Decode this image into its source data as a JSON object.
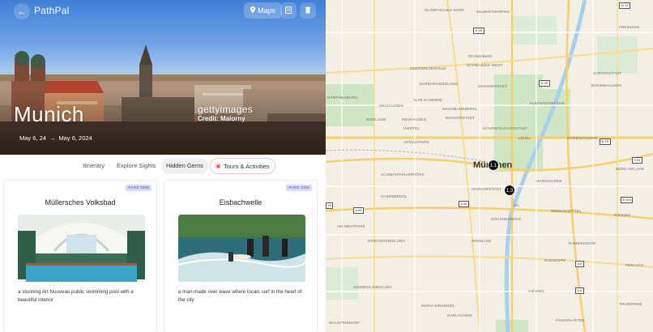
{
  "app": {
    "name": "PathPal",
    "maps_label": "Maps"
  },
  "hero": {
    "city": "Munich",
    "date_start": "May 6, 24",
    "date_arrow": "→",
    "date_end": "May 6, 2024",
    "watermark": "gettyimages",
    "credit": "Credit: Malorny"
  },
  "tabs": [
    {
      "label": "Itinerary"
    },
    {
      "label": "Explore Sights"
    },
    {
      "label": "Hidden Gems",
      "active": true
    },
    {
      "label": "Tours & Activities",
      "icon": "ticket-icon"
    }
  ],
  "cards": [
    {
      "title": "Müllersches Volksbad",
      "badge": "RARE GEM",
      "description": "a stunning Art Nouveau public swimming pool with a beautiful interior"
    },
    {
      "title": "Eisbachwelle",
      "badge": "RARE GEM",
      "description": "a man-made river wave where locals surf in the heart of the city"
    }
  ],
  "map": {
    "city": "München",
    "markers": [
      "1.1",
      "1.3"
    ],
    "districts": [
      "OLYMPISCHES DORF",
      "MILBERTSHOFEN",
      "OBERWIESENFELD",
      "SCHWABING",
      "FREIMANN",
      "BARBARASIEDLUNG",
      "NYMPHENBURG",
      "ALTE KASERNE",
      "MAXVORSTADT",
      "SCHWABING WEST",
      "NEUHAUSEN",
      "MASSMANNBERGL",
      "GARTENSTADT",
      "BOGENHAUSEN",
      "KLEINHESSELOHE",
      "SIEDLUNG",
      "NEUHAUSEN",
      "MAXVORSTADT",
      "VIERTEL",
      "SCHÖNFELDVORSTADT",
      "ARNULFPARK",
      "LEHEL",
      "BOGENHAUSEN",
      "SCHWANTHALERHÖHE",
      "HAIDHAUSEN",
      "HASENBERGL",
      "ISARVORSTADT",
      "AU",
      "AM WESTPARK",
      "GIESING",
      "KRIEGERSIEDLUNG",
      "NOCKHERBERG",
      "WERKSVIERTEL",
      "RAMERSDORF",
      "SENDLING",
      "SIEMENS-SIEDLUNG",
      "NUSSDORF",
      "PERLACH",
      "GIESING",
      "MARIA EINSIEDEL",
      "HARLACHING",
      "FASANGARTEN",
      "WALDFRIEDHOF",
      "BERG AM LAIM",
      "TRUDERING"
    ],
    "roads": [
      "M 13",
      "B 2R",
      "B 2R",
      "B 2R",
      "A 94",
      "B 304",
      "A 96",
      "A 96",
      "A 8",
      "A 8",
      "96"
    ]
  },
  "colors": {
    "accent": "#e85c4a",
    "badge_bg": "#d9dbf5",
    "badge_text": "#4a4fae",
    "marker": "#111111"
  }
}
